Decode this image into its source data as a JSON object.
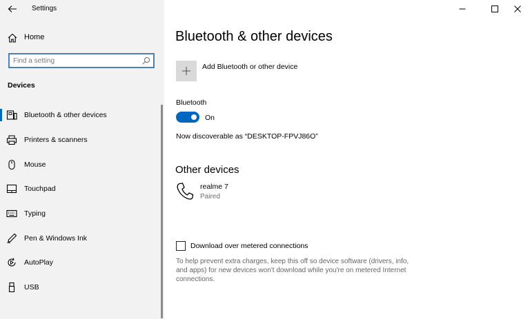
{
  "window": {
    "title": "Settings",
    "controls": [
      "minimize",
      "maximize",
      "close"
    ]
  },
  "sidebar": {
    "home_label": "Home",
    "search": {
      "placeholder": "Find a setting",
      "value": ""
    },
    "section_header": "Devices",
    "items": [
      {
        "label": "Bluetooth & other devices",
        "icon": "bluetooth-devices-icon",
        "selected": true
      },
      {
        "label": "Printers & scanners",
        "icon": "printer-icon",
        "selected": false
      },
      {
        "label": "Mouse",
        "icon": "mouse-icon",
        "selected": false
      },
      {
        "label": "Touchpad",
        "icon": "touchpad-icon",
        "selected": false
      },
      {
        "label": "Typing",
        "icon": "keyboard-icon",
        "selected": false
      },
      {
        "label": "Pen & Windows Ink",
        "icon": "pen-icon",
        "selected": false
      },
      {
        "label": "AutoPlay",
        "icon": "autoplay-icon",
        "selected": false
      },
      {
        "label": "USB",
        "icon": "usb-icon",
        "selected": false
      }
    ]
  },
  "main": {
    "title": "Bluetooth & other devices",
    "add_device_label": "Add Bluetooth or other device",
    "bluetooth": {
      "label": "Bluetooth",
      "state": "On",
      "enabled": true,
      "discoverable_text": "Now discoverable as “DESKTOP-FPVJ86O”"
    },
    "other_devices": {
      "title": "Other devices",
      "devices": [
        {
          "name": "realme 7",
          "status": "Paired",
          "icon": "phone-icon"
        }
      ]
    },
    "metered": {
      "label": "Download over metered connections",
      "checked": false,
      "help": "To help prevent extra charges, keep this off so device software (drivers, info, and apps) for new devices won't download while you're on metered Internet connections."
    }
  },
  "colors": {
    "accent": "#0067c0",
    "sidebar_bg": "#f2f2f2",
    "search_border": "#4a7fb8"
  }
}
